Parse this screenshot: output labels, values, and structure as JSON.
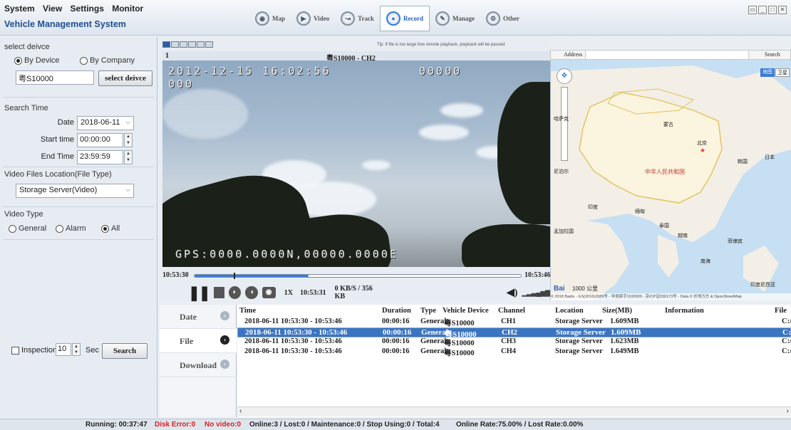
{
  "menu": {
    "system": "System",
    "view": "View",
    "settings": "Settings",
    "monitor": "Monitor"
  },
  "app_title": "Vehicle Management System",
  "nav": [
    {
      "label": "Map",
      "icon": "map-icon"
    },
    {
      "label": "Video",
      "icon": "video-icon"
    },
    {
      "label": "Track",
      "icon": "track-icon"
    },
    {
      "label": "Record",
      "icon": "record-icon",
      "active": true
    },
    {
      "label": "Manage",
      "icon": "manage-icon"
    },
    {
      "label": "Other",
      "icon": "other-icon"
    }
  ],
  "left": {
    "select_device_title": "select deivce",
    "by_device": "By Device",
    "by_company": "By Company",
    "device_value": "粤S10000",
    "select_device_btn": "select deivce",
    "search_time_title": "Search Time",
    "date_label": "Date",
    "date_value": "2018-06-11",
    "start_label": "Start time",
    "start_value": "00:00:00",
    "end_label": "End Time",
    "end_value": "23:59:59",
    "location_title": "Video Files Location(File Type)",
    "location_value": "Storage Server(Video)",
    "video_type_title": "Video Type",
    "type_general": "General",
    "type_alarm": "Alarm",
    "type_all": "All",
    "inspection_label": "Inspection",
    "inspection_value": "10",
    "sec_label": "Sec",
    "search_btn": "Search"
  },
  "video": {
    "tip": "Tip: If file is too large fore remote playback, playback will be paused",
    "index": "1",
    "title": "粤S10000 - CH2",
    "osd_datetime": "2012-12-15 16:02:56",
    "osd_counter": "00000",
    "osd_small": "000",
    "osd_gps": "GPS:0000.0000N,00000.0000E",
    "time_start": "10:53:30",
    "time_end": "10:53:46",
    "progress": 0.35,
    "speed": "1X",
    "current_time": "10:53:31",
    "rate": "0 KB/S / 356 KB"
  },
  "map": {
    "address_label": "Address",
    "search_label": "Search",
    "map_btn": "地图",
    "sat_btn": "卫星",
    "labels": {
      "mongolia": "蒙古",
      "beijing": "北京",
      "china": "中华人民共和国",
      "japan": "日本",
      "korea": "韩国",
      "india": "印度",
      "myanmar": "缅甸",
      "thailand": "泰国",
      "vietnam": "越南",
      "philippines": "菲律宾",
      "kazakh": "哈萨克",
      "nepal": "尼泊尔",
      "bangladesh": "孟加拉国",
      "south_china_sea": "南海",
      "indonesia": "印度尼西亚"
    },
    "scale": "1000 公里",
    "copyright": "© 2018 Baidu - GS(2016)2089号 - 甲测资字1100930 - 京ICP证030173号 - Data © 长地万方 & OpenStreetMap"
  },
  "tabs": [
    {
      "label": "Date"
    },
    {
      "label": "File",
      "active": true
    },
    {
      "label": "Download"
    }
  ],
  "table": {
    "headers": [
      "Time",
      "Duration",
      "Type",
      "Vehicle Device",
      "Channel",
      "Location",
      "Size(MB)",
      "Information",
      "File"
    ],
    "rows": [
      [
        "2018-06-11 10:53:30 - 10:53:46",
        "00:00:16",
        "General",
        "粤S10000",
        "CH1",
        "Storage Server",
        "1.609MB",
        "",
        "C:/("
      ],
      [
        "2018-06-11 10:53:30 - 10:53:46",
        "00:00:16",
        "General",
        "粤S10000",
        "CH2",
        "Storage Server",
        "1.609MB",
        "",
        "C:/("
      ],
      [
        "2018-06-11 10:53:30 - 10:53:46",
        "00:00:16",
        "General",
        "粤S10000",
        "CH3",
        "Storage Server",
        "1.623MB",
        "",
        "C:/("
      ],
      [
        "2018-06-11 10:53:30 - 10:53:46",
        "00:00:16",
        "General",
        "粤S10000",
        "CH4",
        "Storage Server",
        "1.649MB",
        "",
        "C:/("
      ]
    ],
    "selected_row": 1
  },
  "status": {
    "running": "Running: 00:37:47",
    "disk_error": "Disk Error:0",
    "no_video": "No video:0",
    "summary": "Online:3 / Lost:0 / Maintenance:0 / Stop Using:0 / Total:4",
    "online_rate": "Online Rate:75.00% / Lost Rate:0.00%"
  }
}
